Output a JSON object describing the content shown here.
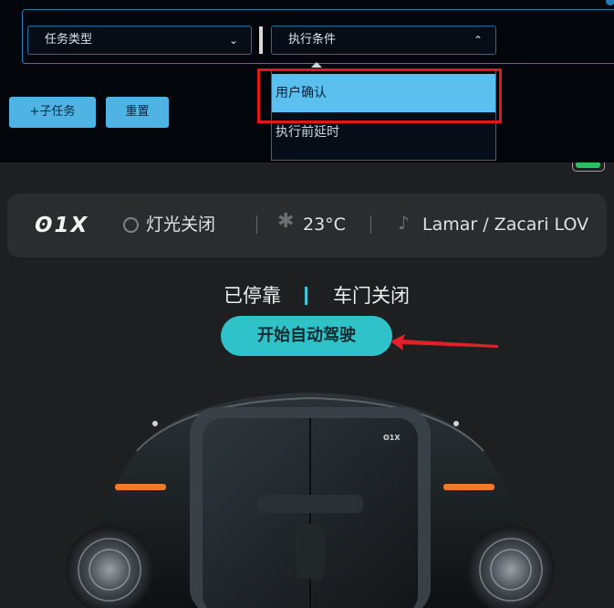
{
  "task_panel": {
    "task_type_select": "任务类型",
    "exec_condition_select": "执行条件",
    "dropdown_options": [
      "用户确认",
      "执行前延时"
    ],
    "add_subtask_label": "+子任务",
    "reset_label": "重置",
    "highlight_color": "#e01818",
    "accent_color": "#1f7fb6"
  },
  "vehicle_app": {
    "brand_logo": "ʘ1X",
    "light_status": "灯光关闭",
    "temperature": "23°C",
    "track": "Lamar / Zacari  LOV",
    "park_status": "已停靠",
    "door_status": "车门关闭",
    "start_button_label": "开始自动驾驶",
    "vehicle_badge": "ʘ1X",
    "button_color": "#2fc3c9",
    "icons": [
      "battery-icon",
      "light-icon",
      "temperature-icon",
      "music-icon",
      "arrow-icon"
    ]
  }
}
